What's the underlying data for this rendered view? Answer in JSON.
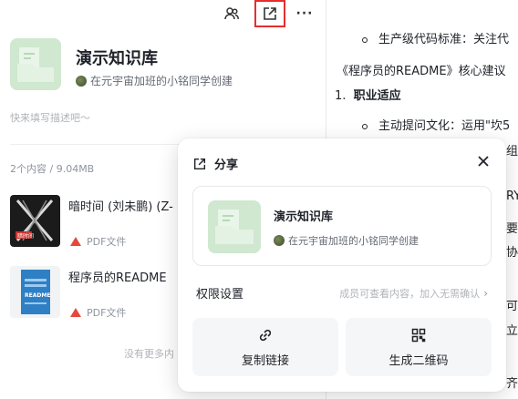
{
  "knowledge_base": {
    "title": "演示知识库",
    "creator": "在元宇宙加班的小铭同学创建",
    "description_placeholder": "快来填写描述吧～",
    "content_count": "2个内容 / 9.04MB",
    "footer": "没有更多内"
  },
  "toolbar": {
    "members_icon": "members-icon",
    "share_icon": "share-icon",
    "more_label": "···"
  },
  "documents": [
    {
      "name": "暗时间 (刘未鹏) (Z-",
      "type": "PDF文件",
      "cover_text": "暗时间"
    },
    {
      "name": "程序员的README",
      "type": "PDF文件",
      "cover_text": "README"
    }
  ],
  "right_pane": {
    "lines": [
      "生产级代码标准：关注代",
      "《程序员的README》核心建议",
      "1.",
      "职业适应",
      "主动提问文化：运用\"坎5",
      "组",
      "RY",
      "要",
      "协",
      "可",
      "立",
      "齐"
    ]
  },
  "share_popup": {
    "title": "分享",
    "card_title": "演示知识库",
    "card_creator": "在元宇宙加班的小铭同学创建",
    "permission_label": "权限设置",
    "permission_value": "成员可查看内容，加入无需确认",
    "copy_link_label": "复制链接",
    "qr_label": "生成二维码"
  },
  "colors": {
    "highlight_border": "#e52e2e",
    "cover_green": "#cfe8cf",
    "pdf_red": "#e5483a"
  }
}
